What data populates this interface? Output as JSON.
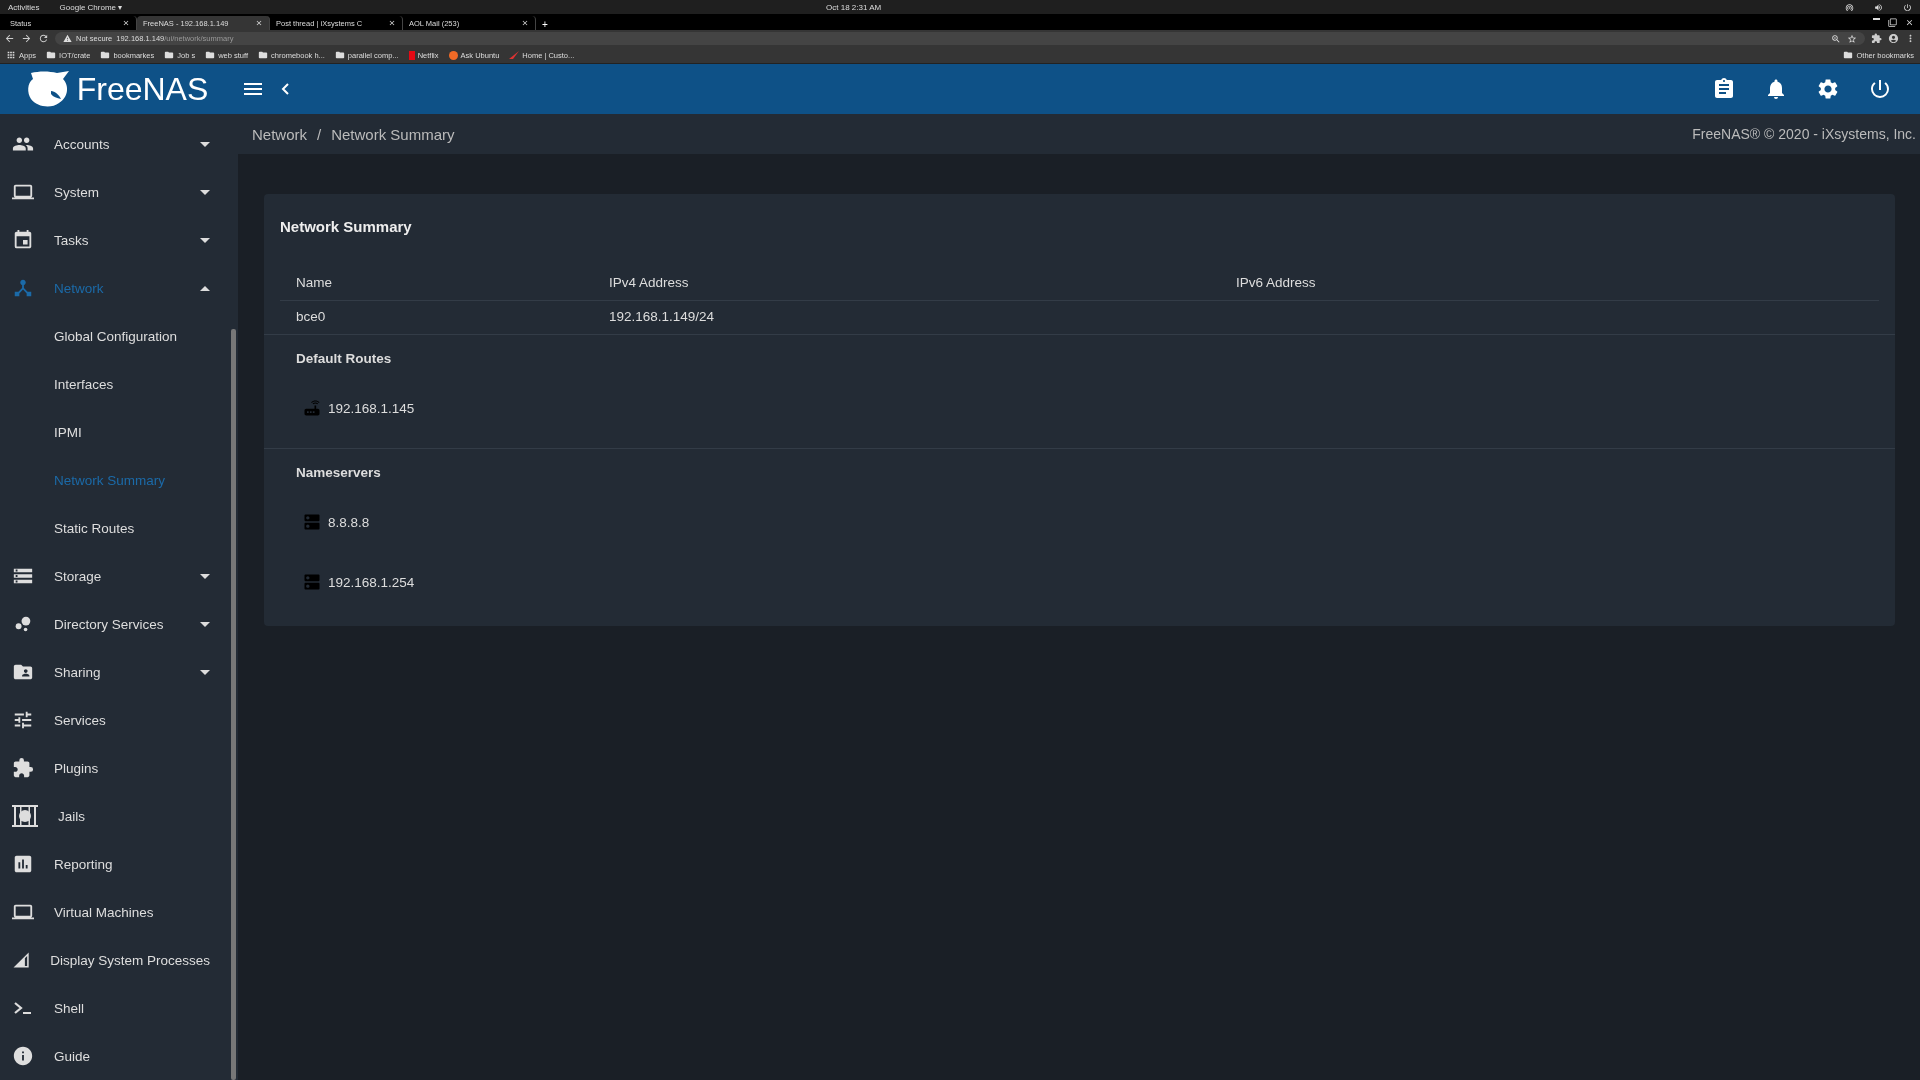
{
  "os_bar": {
    "activities": "Activities",
    "app_menu": "Google Chrome ▾",
    "clock": "Oct 18  2:31 AM"
  },
  "browser": {
    "tabs": [
      {
        "title": "Status",
        "selected": false
      },
      {
        "title": "FreeNAS - 192.168.1.149",
        "selected": true
      },
      {
        "title": "Post thread | iXsystems C",
        "selected": false
      },
      {
        "title": "AOL Mail (253)",
        "selected": false
      }
    ],
    "new_tab": "+",
    "address": {
      "security": "Not secure",
      "host": "192.168.1.149",
      "path": "/ui/network/summary"
    },
    "bookmarks": [
      {
        "label": "Apps",
        "kind": "apps"
      },
      {
        "label": "IOT/crate",
        "kind": "folder"
      },
      {
        "label": "bookmarkes",
        "kind": "folder"
      },
      {
        "label": "Job s",
        "kind": "folder"
      },
      {
        "label": "web stuff",
        "kind": "folder"
      },
      {
        "label": "chromebook h...",
        "kind": "folder"
      },
      {
        "label": "parallel comp...",
        "kind": "folder"
      },
      {
        "label": "Netflix",
        "kind": "netflix"
      },
      {
        "label": "Ask Ubuntu",
        "kind": "askubuntu"
      },
      {
        "label": "Home | Custo...",
        "kind": "site"
      }
    ],
    "other_bookmarks": "Other bookmarks"
  },
  "app": {
    "logo": "FreeNAS",
    "breadcrumb": [
      "Network",
      "Network Summary"
    ],
    "breadcrumb_separator": "/",
    "copyright": "FreeNAS® © 2020 - iXsystems, Inc.",
    "sidebar": [
      {
        "label": "Accounts",
        "expanded": false,
        "selected": false
      },
      {
        "label": "System",
        "expanded": false,
        "selected": false
      },
      {
        "label": "Tasks",
        "expanded": false,
        "selected": false
      },
      {
        "label": "Network",
        "expanded": true,
        "selected": true,
        "children": [
          {
            "label": "Global Configuration",
            "selected": false
          },
          {
            "label": "Interfaces",
            "selected": false
          },
          {
            "label": "IPMI",
            "selected": false
          },
          {
            "label": "Network Summary",
            "selected": true
          },
          {
            "label": "Static Routes",
            "selected": false
          }
        ]
      },
      {
        "label": "Storage",
        "expanded": false,
        "selected": false
      },
      {
        "label": "Directory Services",
        "expanded": false,
        "selected": false
      },
      {
        "label": "Sharing",
        "expanded": false,
        "selected": false
      },
      {
        "label": "Services",
        "selected": false
      },
      {
        "label": "Plugins",
        "selected": false
      },
      {
        "label": "Jails",
        "selected": false
      },
      {
        "label": "Reporting",
        "selected": false
      },
      {
        "label": "Virtual Machines",
        "selected": false
      },
      {
        "label": "Display System Processes",
        "selected": false
      },
      {
        "label": "Shell",
        "selected": false
      },
      {
        "label": "Guide",
        "selected": false
      }
    ],
    "card": {
      "title": "Network Summary",
      "columns": [
        "Name",
        "IPv4 Address",
        "IPv6 Address"
      ],
      "rows": [
        [
          "bce0",
          "192.168.1.149/24",
          ""
        ]
      ],
      "default_routes": {
        "title": "Default Routes",
        "items": [
          "192.168.1.145"
        ]
      },
      "nameservers": {
        "title": "Nameservers",
        "items": [
          "8.8.8.8",
          "192.168.1.254"
        ]
      }
    }
  }
}
